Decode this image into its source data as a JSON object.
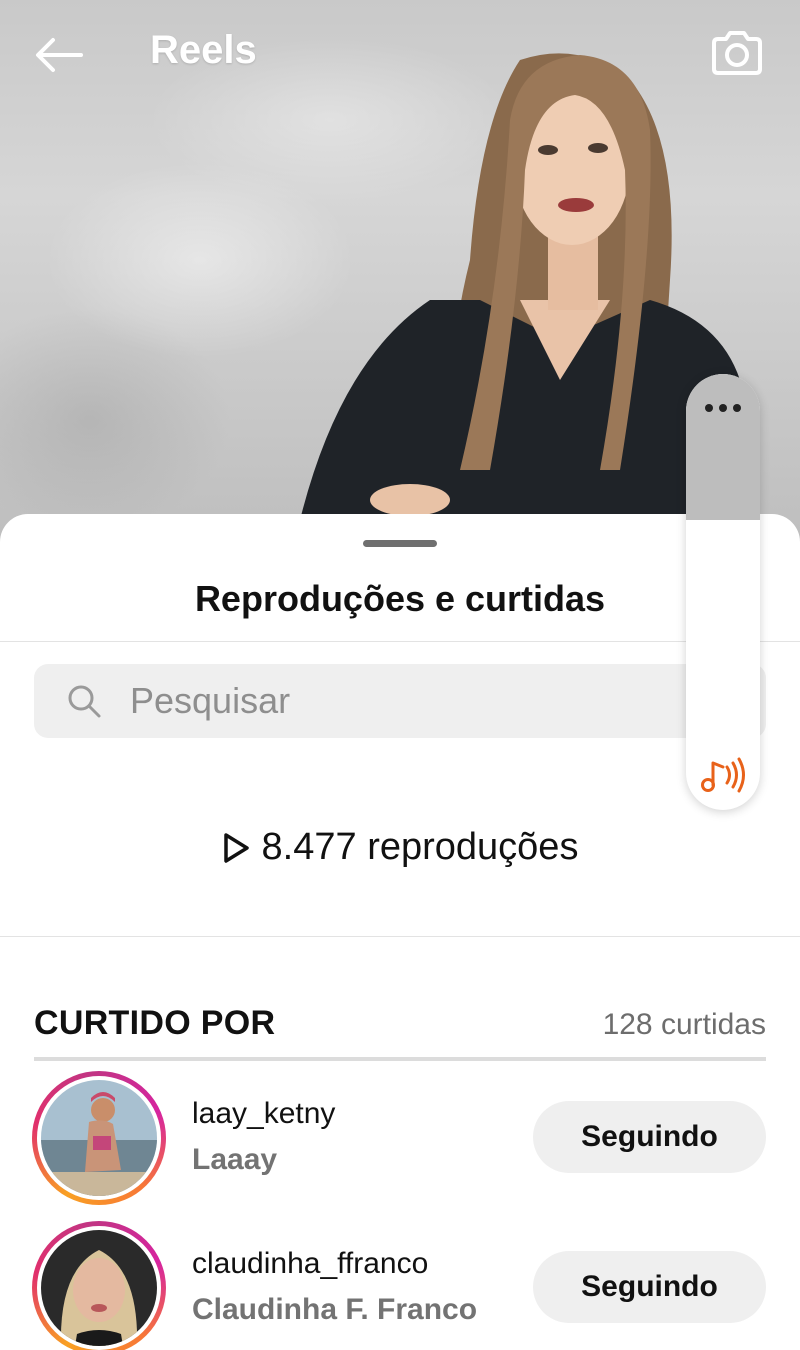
{
  "header": {
    "title": "Reels",
    "back_icon": "arrow-left-icon",
    "camera_icon": "camera-icon"
  },
  "sheet": {
    "title": "Reproduções e curtidas",
    "search": {
      "placeholder": "Pesquisar",
      "icon": "search-icon"
    },
    "plays": {
      "icon": "play-icon",
      "text": "8.477 reproduções"
    },
    "liked_by": {
      "title": "CURTIDO POR",
      "count": "128 curtidas",
      "users": [
        {
          "username": "laay_ketny",
          "full_name": "Laaay",
          "button": "Seguindo"
        },
        {
          "username": "claudinha_ffranco",
          "full_name": "Claudinha F. Franco",
          "button": "Seguindo"
        }
      ]
    }
  },
  "floating_widget": {
    "more_icon": "more-dots-icon",
    "audio_icon": "music-sound-icon"
  },
  "colors": {
    "accent_audio": "#e8621a",
    "button_bg": "#efefef",
    "story_ring": [
      "#f9a023",
      "#e1306c",
      "#c13584"
    ]
  }
}
